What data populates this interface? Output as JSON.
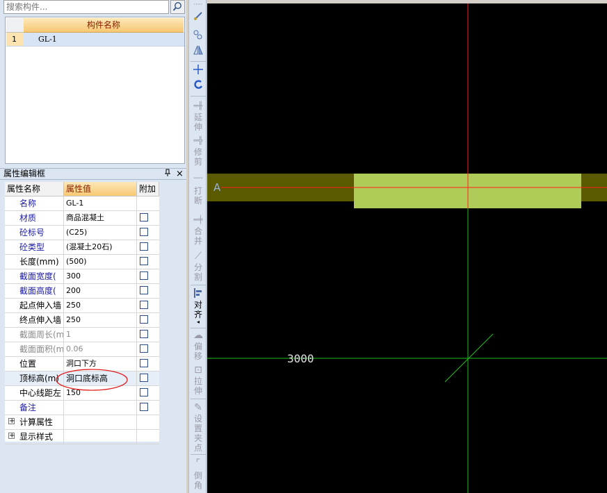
{
  "search": {
    "placeholder": "搜索构件..."
  },
  "component_list": {
    "column_header": "构件名称",
    "rows": [
      {
        "index": "1",
        "name": "GL-1"
      }
    ]
  },
  "property_panel": {
    "title": "属性编辑框",
    "pin_glyph": "ᚊ",
    "close_glyph": "×",
    "headers": {
      "name": "属性名称",
      "value": "属性值",
      "extra": "附加"
    },
    "rows": [
      {
        "name": "名称",
        "value": "GL-1"
      },
      {
        "name": "材质",
        "value": "商品混凝土"
      },
      {
        "name": "砼标号",
        "value": "(C25)"
      },
      {
        "name": "砼类型",
        "value": "(混凝土20石)"
      },
      {
        "name": "长度(mm)",
        "value": "(500)"
      },
      {
        "name": "截面宽度(",
        "value": "300"
      },
      {
        "name": "截面高度(",
        "value": "200"
      },
      {
        "name": "起点伸入墙",
        "value": "250"
      },
      {
        "name": "终点伸入墙",
        "value": "250"
      },
      {
        "name": "截面周长(m",
        "value": "1"
      },
      {
        "name": "截面面积(m",
        "value": "0.06"
      },
      {
        "name": "位置",
        "value": "洞口下方"
      },
      {
        "name": "顶标高(m)",
        "value": "洞口底标高"
      },
      {
        "name": "中心线距左",
        "value": "150"
      },
      {
        "name": "备注",
        "value": ""
      }
    ],
    "groups": [
      {
        "expand": "+",
        "label": "计算属性"
      },
      {
        "expand": "+",
        "label": "显示样式"
      }
    ]
  },
  "toolbar": {
    "labels": {
      "extend": [
        "延",
        "伸"
      ],
      "trim": [
        "修",
        "剪"
      ],
      "break": [
        "打",
        "断"
      ],
      "merge": [
        "合",
        "并"
      ],
      "split": [
        "分",
        "割"
      ],
      "align": [
        "对",
        "齐"
      ],
      "offset": [
        "偏",
        "移"
      ],
      "stretch": [
        "拉",
        "伸"
      ],
      "set_grip": [
        "设",
        "置",
        "夹",
        "点"
      ],
      "chamfer": [
        "倒",
        "角"
      ]
    }
  },
  "canvas": {
    "axis_label": "A",
    "dimension_text": "3000",
    "colors": {
      "background": "#000000",
      "band": "#5a5a00",
      "beam": "#b0cc58",
      "red_line": "#ff2020",
      "green_line": "#20c020",
      "axis_label": "#9ab0d8",
      "dimension_text": "#e0e0e0"
    }
  }
}
